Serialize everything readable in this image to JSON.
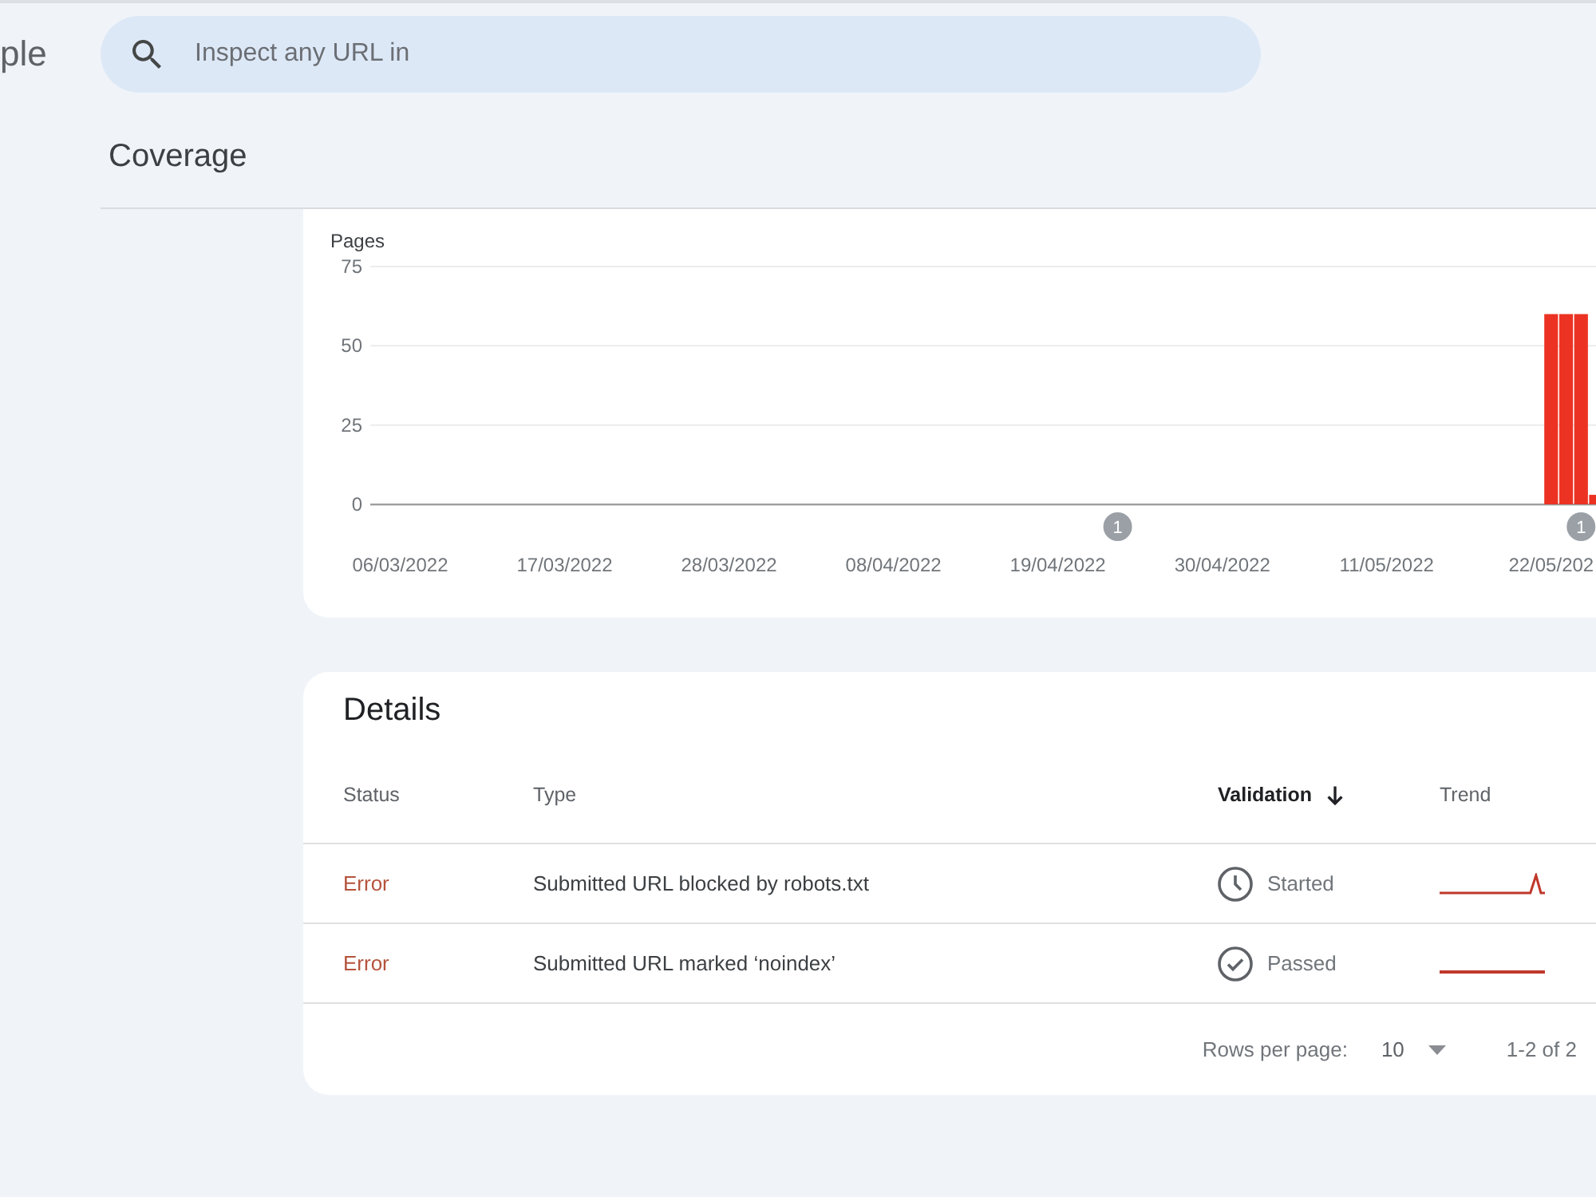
{
  "header": {
    "logo_text": "ple",
    "search": {
      "placeholder": "Inspect any URL in"
    }
  },
  "page_title": "Coverage",
  "chart": {
    "chart_data": {
      "type": "bar",
      "ylabel": "Pages",
      "categories": [
        "06/03/2022",
        null,
        null,
        null,
        null,
        null,
        null,
        null,
        null,
        null,
        null,
        "17/03/2022",
        null,
        null,
        null,
        null,
        null,
        null,
        null,
        null,
        null,
        null,
        "28/03/2022",
        null,
        null,
        null,
        null,
        null,
        null,
        null,
        null,
        null,
        null,
        "08/04/2022",
        null,
        null,
        null,
        null,
        null,
        null,
        null,
        null,
        null,
        null,
        "19/04/2022",
        null,
        null,
        null,
        null,
        null,
        null,
        null,
        null,
        null,
        null,
        "30/04/2022",
        null,
        null,
        null,
        null,
        null,
        null,
        null,
        null,
        null,
        null,
        "11/05/2022",
        null,
        null,
        null,
        null,
        null,
        null,
        null,
        null,
        null,
        null,
        "22/05/202",
        null,
        null,
        null
      ],
      "values": [
        0,
        0,
        0,
        0,
        0,
        0,
        0,
        0,
        0,
        0,
        0,
        0,
        0,
        0,
        0,
        0,
        0,
        0,
        0,
        0,
        0,
        0,
        0,
        0,
        0,
        0,
        0,
        0,
        0,
        0,
        0,
        0,
        0,
        0,
        0,
        0,
        0,
        0,
        0,
        0,
        0,
        0,
        0,
        0,
        0,
        0,
        0,
        0,
        0,
        0,
        0,
        0,
        0,
        0,
        0,
        0,
        0,
        0,
        0,
        0,
        0,
        0,
        0,
        0,
        0,
        0,
        0,
        0,
        0,
        0,
        0,
        0,
        0,
        0,
        0,
        0,
        0,
        60,
        60,
        60,
        3
      ],
      "ylim": [
        0,
        75
      ],
      "yticks": [
        0,
        25,
        50,
        75
      ],
      "annotations": [
        "1",
        "1"
      ]
    }
  },
  "details": {
    "title": "Details",
    "columns": [
      {
        "label": "Status",
        "sorted": false
      },
      {
        "label": "Type",
        "sorted": false
      },
      {
        "label": "Validation",
        "sorted": true
      },
      {
        "label": "Trend",
        "sorted": false
      }
    ],
    "rows": [
      {
        "status": "Error",
        "type": "Submitted URL blocked by robots.txt",
        "validation": {
          "kind": "started",
          "label": "Started"
        },
        "trend": {
          "kind": "spike"
        }
      },
      {
        "status": "Error",
        "type": "Submitted URL marked ‘noindex’",
        "validation": {
          "kind": "passed",
          "label": "Passed"
        },
        "trend": {
          "kind": "flat"
        }
      }
    ],
    "pagination": {
      "rows_per_page_label": "Rows per page:",
      "rows_per_page": "10",
      "range": "1-2 of 2"
    }
  }
}
